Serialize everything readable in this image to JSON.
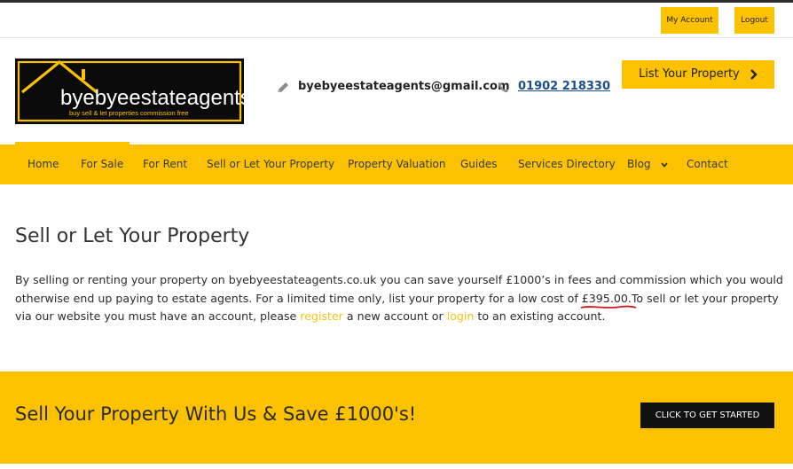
{
  "topbar": {
    "my_account": "My Account",
    "logout": "Logout"
  },
  "brand": {
    "name": "byebyeestateagents",
    "tagline": "buy  sell & let properties  commission free"
  },
  "contact": {
    "email": "byebyeestateagents@gmail.com",
    "phone": "01902 218330",
    "email_icon": "pencil-icon",
    "phone_icon": "phone-icon"
  },
  "list_button": {
    "label": "List Your Property",
    "icon": "chevron-right-icon"
  },
  "nav": {
    "items": [
      {
        "label": "Home"
      },
      {
        "label": "For Sale"
      },
      {
        "label": "For Rent"
      },
      {
        "label": "Sell or Let Your Property"
      },
      {
        "label": "Property Valuation"
      },
      {
        "label": "Guides"
      },
      {
        "label": "Services Directory"
      },
      {
        "label": "Blog"
      },
      {
        "label": "Contact"
      }
    ],
    "blog_icon": "chevron-down-icon"
  },
  "main": {
    "title": "Sell or Let Your Property",
    "p_part1": "By selling or renting your property on byebyeestateagents.co.uk you can save yourself £1000’s in fees and commission which you would otherwise end up paying to estate agents. For a limited time only, list your property for a low cost of ",
    "price": "£395.00.",
    "p_part2": "To sell or let your property via our website you must have an account, please ",
    "register_link": "register",
    "p_part3": " a new account or ",
    "login_link": "login",
    "p_part4": " to an existing account."
  },
  "promo": {
    "title": "Sell Your Property With Us & Save £1000's!",
    "cta": "CLICK TO GET STARTED"
  },
  "colors": {
    "accent": "#fcc200",
    "dark": "#111111",
    "link_blue": "#1a4f8c",
    "annotation_red": "#d11a1a"
  }
}
